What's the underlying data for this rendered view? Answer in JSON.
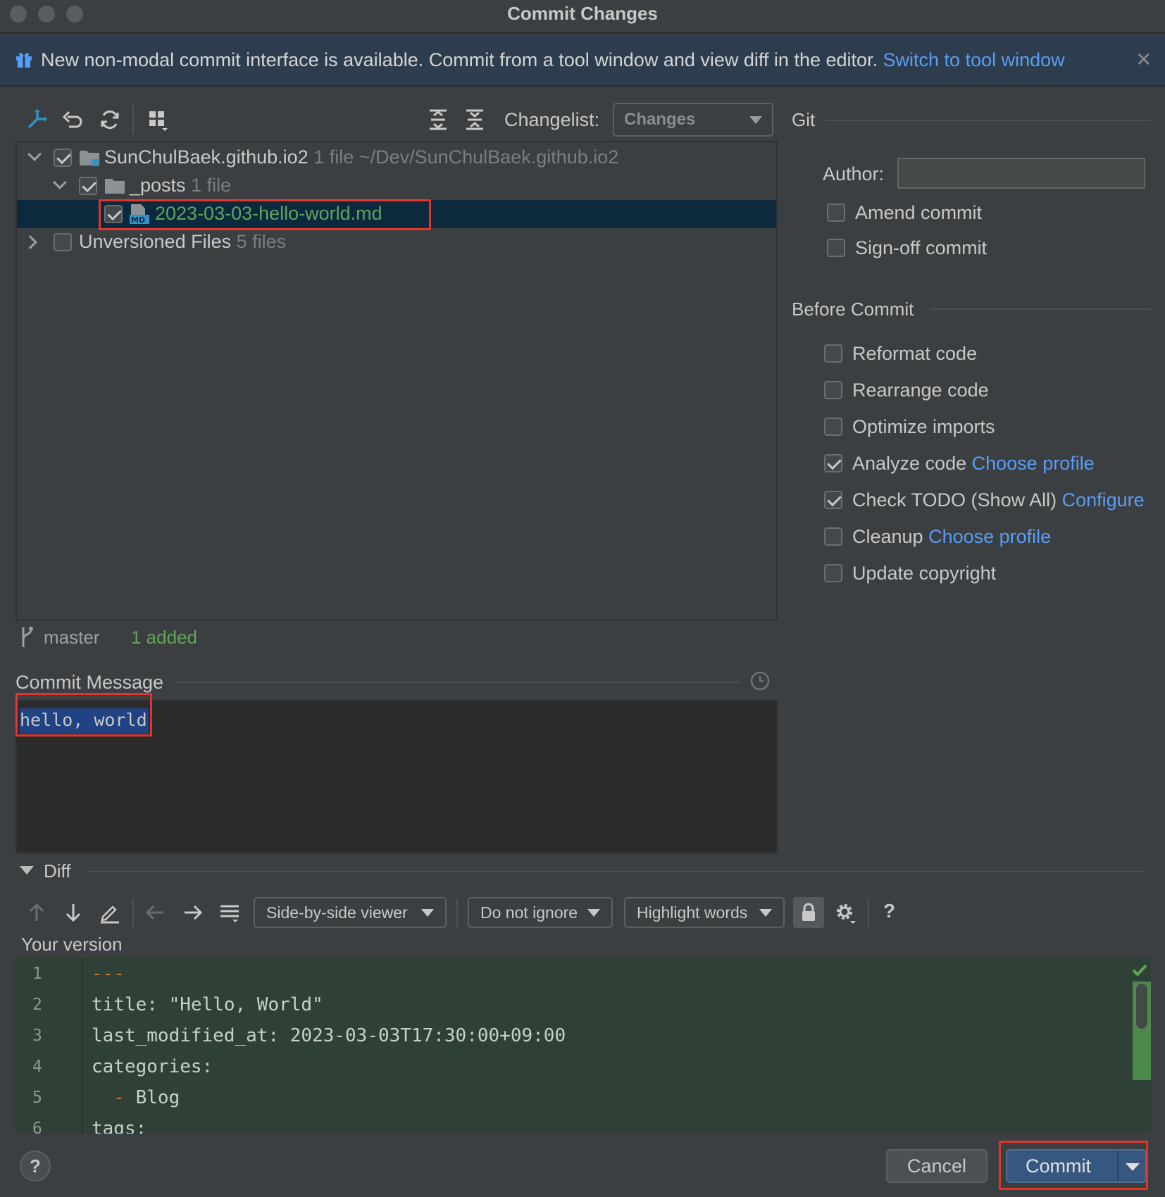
{
  "window": {
    "title": "Commit Changes"
  },
  "banner": {
    "text": "New non-modal commit interface is available. Commit from a tool window and view diff in the editor. ",
    "link": "Switch to tool window",
    "gift_icon": "gift-icon",
    "close_icon": "close-icon"
  },
  "toolbar": {
    "icons": [
      "show-diff-icon",
      "rollback-icon",
      "refresh-icon",
      "group-by-icon",
      "expand-all-icon",
      "collapse-all-icon"
    ]
  },
  "changelist": {
    "label": "Changelist:",
    "value": "Changes"
  },
  "tree": {
    "root": {
      "name": "SunChulBaek.github.io2",
      "count": "1 file",
      "path": "~/Dev/SunChulBaek.github.io2"
    },
    "folder": {
      "name": "_posts",
      "count": "1 file"
    },
    "file": {
      "name": "2023-03-03-hello-world.md",
      "type_badge": "MD"
    },
    "unversioned": {
      "name": "Unversioned Files",
      "count": "5 files"
    }
  },
  "status": {
    "branch": "master",
    "summary": "1 added"
  },
  "commit_message": {
    "label": "Commit Message",
    "text": "hello, world"
  },
  "git": {
    "title": "Git",
    "author_label": "Author:",
    "author_value": "",
    "amend": "Amend commit",
    "signoff": "Sign-off commit"
  },
  "before_commit": {
    "title": "Before Commit",
    "reformat": "Reformat code",
    "rearrange": "Rearrange code",
    "optimize": "Optimize imports",
    "analyze": "Analyze code",
    "analyze_link": "Choose profile",
    "todo": "Check TODO (Show All)",
    "todo_link": "Configure",
    "cleanup": "Cleanup",
    "cleanup_link": "Choose profile",
    "copyright": "Update copyright"
  },
  "diff": {
    "title": "Diff",
    "viewer": "Side-by-side viewer",
    "ignore": "Do not ignore",
    "highlight": "Highlight words",
    "help": "?",
    "your_version": "Your version",
    "lines": [
      {
        "n": "1",
        "text": "---"
      },
      {
        "n": "2",
        "text": "title: \"Hello, World\""
      },
      {
        "n": "3",
        "text": "last_modified_at: 2023-03-03T17:30:00+09:00"
      },
      {
        "n": "4",
        "text": "categories:"
      },
      {
        "n": "5",
        "dash": "  -",
        "text": " Blog"
      },
      {
        "n": "6",
        "text": "tags:"
      }
    ]
  },
  "buttons": {
    "help": "?",
    "cancel": "Cancel",
    "commit": "Commit"
  },
  "colors": {
    "accent": "#365880",
    "link": "#589df6",
    "highlight_box": "#e1352b",
    "added": "#62a35c"
  }
}
